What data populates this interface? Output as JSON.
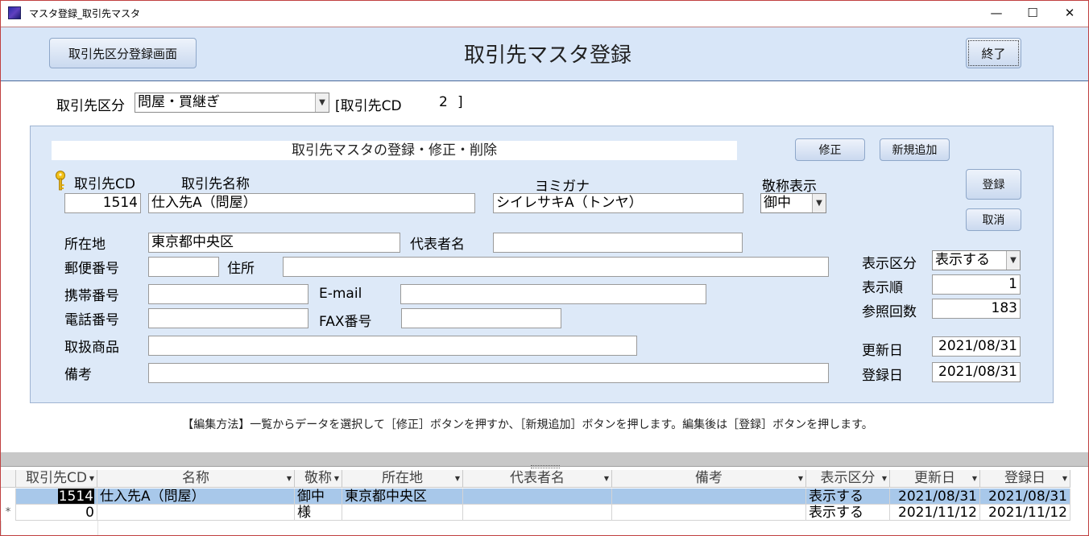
{
  "window": {
    "title": "マスタ登録_取引先マスタ",
    "controls": {
      "minimize": "—",
      "maximize": "☐",
      "close": "✕"
    }
  },
  "header": {
    "category_screen_button": "取引先区分登録画面",
    "title": "取引先マスタ登録",
    "exit_button": "終了"
  },
  "category": {
    "label": "取引先区分",
    "selected": "問屋・買継ぎ",
    "cd_prefix": "[取引先CD",
    "cd_value": "2",
    "cd_suffix": "]"
  },
  "form": {
    "section_title": "取引先マスタの登録・修正・削除",
    "buttons": {
      "edit": "修正",
      "add_new": "新規追加",
      "register": "登録",
      "cancel": "取消"
    },
    "labels": {
      "cd": "取引先CD",
      "name": "取引先名称",
      "kana": "ヨミガナ",
      "honorific": "敬称表示",
      "location": "所在地",
      "representative": "代表者名",
      "zip": "郵便番号",
      "address": "住所",
      "mobile": "携帯番号",
      "email": "E-mail",
      "phone": "電話番号",
      "fax": "FAX番号",
      "products": "取扱商品",
      "notes": "備考",
      "display_flag": "表示区分",
      "display_order": "表示順",
      "ref_count": "参照回数",
      "updated": "更新日",
      "registered": "登録日"
    },
    "values": {
      "cd": "1514",
      "name": "仕入先A（問屋）",
      "kana": "シイレサキA（トンヤ）",
      "honorific": "御中",
      "location": "東京都中央区",
      "representative": "",
      "zip": "",
      "address": "",
      "mobile": "",
      "email": "",
      "phone": "",
      "fax": "",
      "products": "",
      "notes": "",
      "display_flag": "表示する",
      "display_order": "1",
      "ref_count": "183",
      "updated": "2021/08/31",
      "registered": "2021/08/31"
    }
  },
  "instructions": "【編集方法】一覧からデータを選択して［修正］ボタンを押すか、［新規追加］ボタンを押します。編集後は［登録］ボタンを押します。",
  "table": {
    "columns": [
      "取引先CD",
      "名称",
      "敬称",
      "所在地",
      "代表者名",
      "備考",
      "表示区分",
      "更新日",
      "登録日"
    ],
    "rows": [
      {
        "marker": "",
        "cd": "1514",
        "name": "仕入先A（問屋）",
        "honorific": "御中",
        "location": "東京都中央区",
        "rep": "",
        "notes": "",
        "display": "表示する",
        "updated": "2021/08/31",
        "registered": "2021/08/31"
      },
      {
        "marker": "*",
        "cd": "0",
        "name": "",
        "honorific": "様",
        "location": "",
        "rep": "",
        "notes": "",
        "display": "表示する",
        "updated": "2021/11/12",
        "registered": "2021/11/12"
      }
    ]
  }
}
